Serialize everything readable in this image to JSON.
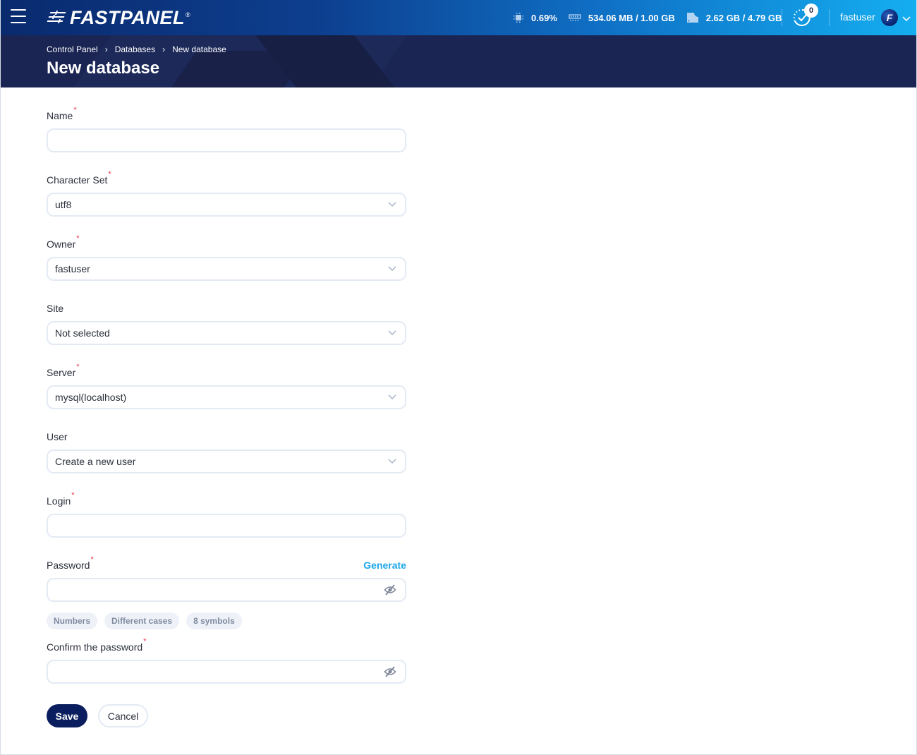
{
  "header": {
    "logo_text": "FASTPANEL",
    "logo_reg": "®",
    "stats": {
      "cpu": "0.69%",
      "memory": "534.06 MB / 1.00 GB",
      "disk": "2.62 GB / 4.79 GB"
    },
    "notifications_count": "0",
    "username": "fastuser",
    "avatar_letter": "F"
  },
  "breadcrumb": [
    {
      "label": "Control Panel"
    },
    {
      "label": "Databases"
    },
    {
      "label": "New database"
    }
  ],
  "page_title": "New database",
  "form": {
    "name": {
      "label": "Name",
      "value": "",
      "required": true
    },
    "charset": {
      "label": "Character Set",
      "value": "utf8",
      "required": true
    },
    "owner": {
      "label": "Owner",
      "value": "fastuser",
      "required": true
    },
    "site": {
      "label": "Site",
      "value": "Not selected",
      "required": false
    },
    "server": {
      "label": "Server",
      "value": "mysql(localhost)",
      "required": true
    },
    "user": {
      "label": "User",
      "value": "Create a new user",
      "required": false
    },
    "login": {
      "label": "Login",
      "value": "",
      "required": true
    },
    "password": {
      "label": "Password",
      "value": "",
      "required": true,
      "generate_label": "Generate"
    },
    "password_hints": [
      "Numbers",
      "Different cases",
      "8 symbols"
    ],
    "confirm_password": {
      "label": "Confirm the password",
      "value": "",
      "required": true
    },
    "required_marker": "*"
  },
  "buttons": {
    "save": "Save",
    "cancel": "Cancel"
  },
  "colors": {
    "primary": "#0a1d5e",
    "link": "#1ea7e8",
    "required": "#e8344e",
    "hero_bg": "#1b2554"
  }
}
